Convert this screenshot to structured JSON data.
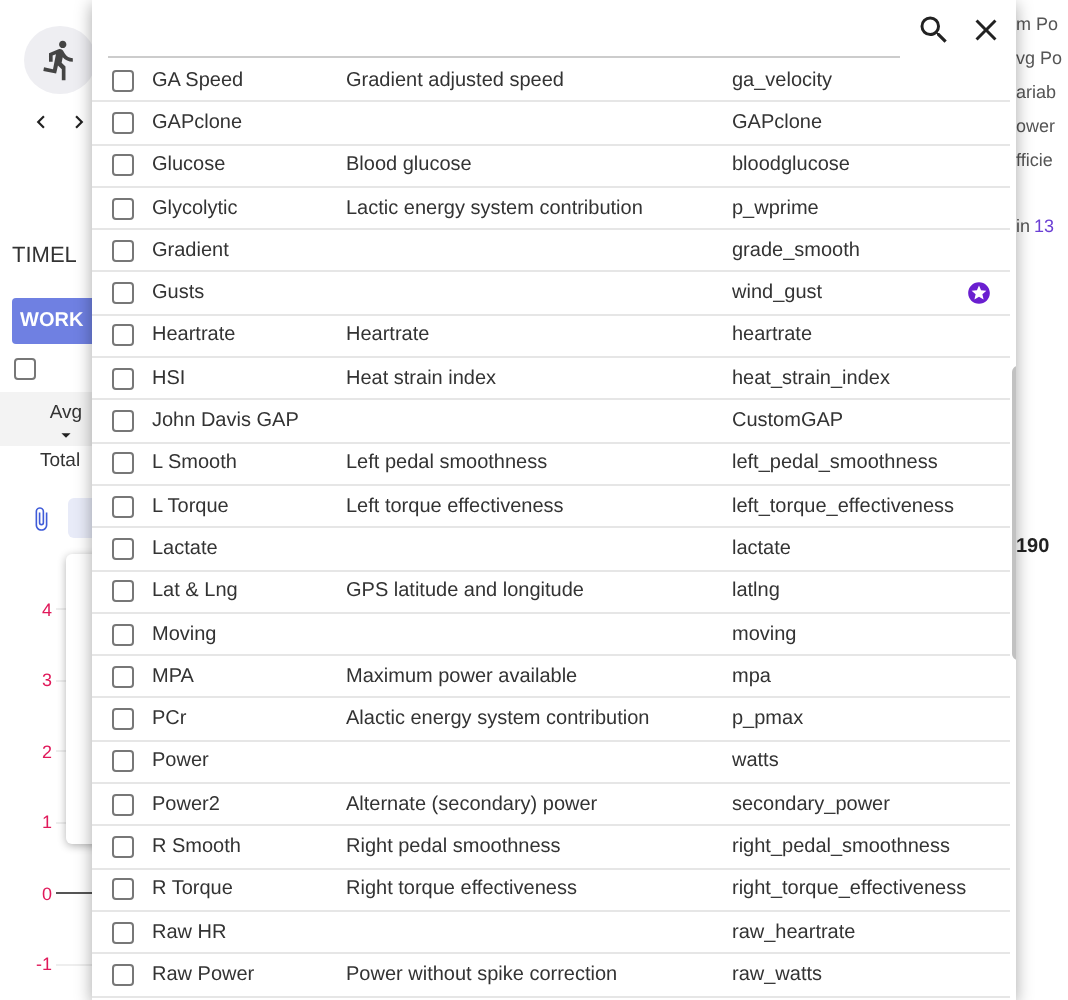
{
  "background": {
    "timeline_tab": "TIMEL",
    "work_button": "WORK",
    "header_checkbox": {
      "checked": false
    },
    "avg_column": "Avg",
    "total_label": "Total",
    "y_ticks": [
      "4",
      "3",
      "2",
      "1",
      "0",
      "-1"
    ],
    "right_labels": [
      "m Po",
      "vg Po",
      "ariab",
      "ower",
      "fficie"
    ],
    "right_count": {
      "label": "in",
      "value": "13"
    },
    "right_value": "190"
  },
  "dialog": {
    "fields": [
      {
        "name": "GA Speed",
        "description": "Gradient adjusted speed",
        "code": "ga_velocity",
        "checked": false,
        "starred": false
      },
      {
        "name": "GAPclone",
        "code": "GAPclone",
        "checked": false,
        "starred": false
      },
      {
        "name": "Glucose",
        "description": "Blood glucose",
        "code": "bloodglucose",
        "checked": false,
        "starred": false
      },
      {
        "name": "Glycolytic",
        "description": "Lactic energy system contribution",
        "code": "p_wprime",
        "checked": false,
        "starred": false
      },
      {
        "name": "Gradient",
        "code": "grade_smooth",
        "checked": false,
        "starred": false
      },
      {
        "name": "Gusts",
        "code": "wind_gust",
        "checked": false,
        "starred": true
      },
      {
        "name": "Heartrate",
        "description": "Heartrate",
        "code": "heartrate",
        "checked": false,
        "starred": false
      },
      {
        "name": "HSI",
        "description": "Heat strain index",
        "code": "heat_strain_index",
        "checked": false,
        "starred": false
      },
      {
        "name": "John Davis GAP",
        "code": "CustomGAP",
        "checked": false,
        "starred": false
      },
      {
        "name": "L Smooth",
        "description": "Left pedal smoothness",
        "code": "left_pedal_smoothness",
        "checked": false,
        "starred": false
      },
      {
        "name": "L Torque",
        "description": "Left torque effectiveness",
        "code": "left_torque_effectiveness",
        "checked": false,
        "starred": false
      },
      {
        "name": "Lactate",
        "code": "lactate",
        "checked": false,
        "starred": false
      },
      {
        "name": "Lat & Lng",
        "description": "GPS latitude and longitude",
        "code": "latlng",
        "checked": false,
        "starred": false
      },
      {
        "name": "Moving",
        "code": "moving",
        "checked": false,
        "starred": false
      },
      {
        "name": "MPA",
        "description": "Maximum power available",
        "code": "mpa",
        "checked": false,
        "starred": false
      },
      {
        "name": "PCr",
        "description": "Alactic energy system contribution",
        "code": "p_pmax",
        "checked": false,
        "starred": false
      },
      {
        "name": "Power",
        "code": "watts",
        "checked": false,
        "starred": false
      },
      {
        "name": "Power2",
        "description": "Alternate (secondary) power",
        "code": "secondary_power",
        "checked": false,
        "starred": false
      },
      {
        "name": "R Smooth",
        "description": "Right pedal smoothness",
        "code": "right_pedal_smoothness",
        "checked": false,
        "starred": false
      },
      {
        "name": "R Torque",
        "description": "Right torque effectiveness",
        "code": "right_torque_effectiveness",
        "checked": false,
        "starred": false
      },
      {
        "name": "Raw HR",
        "code": "raw_heartrate",
        "checked": false,
        "starred": false
      },
      {
        "name": "Raw Power",
        "description": "Power without spike correction",
        "code": "raw_watts",
        "checked": false,
        "starred": false
      }
    ]
  }
}
